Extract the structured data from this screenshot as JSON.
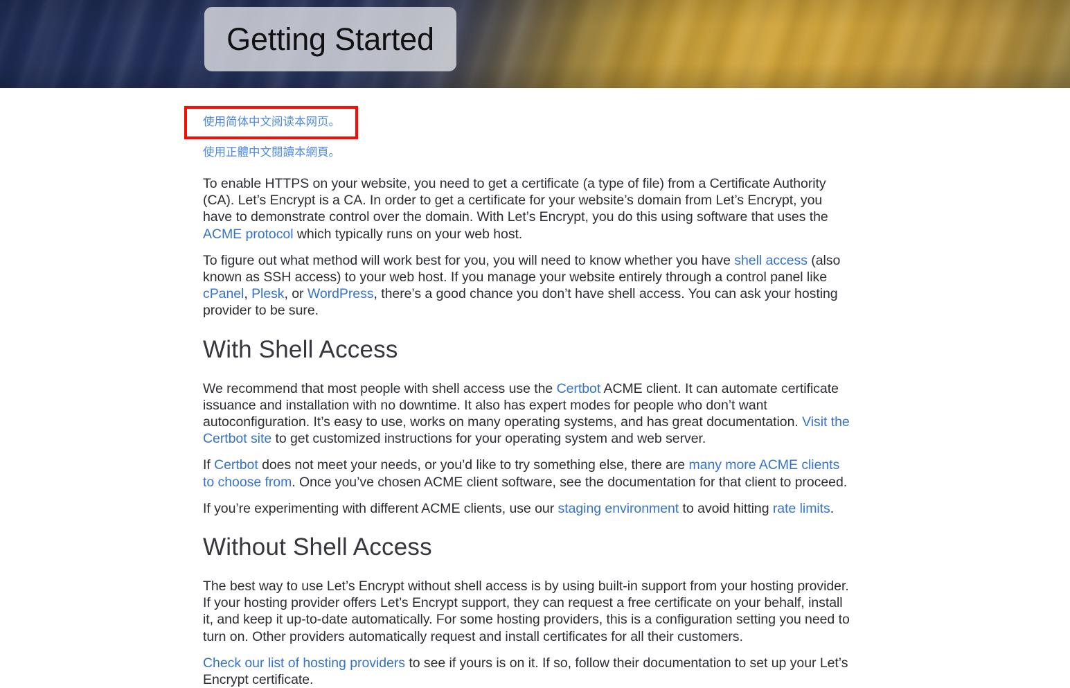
{
  "banner": {
    "title": "Getting Started",
    "gradient_from": "#1f2c55",
    "gradient_to": "#d2a63c",
    "title_box_bg": "rgba(222,224,228,0.80)"
  },
  "theme": {
    "link_color": "#4f8ae0",
    "body_text_color": "#2c2c33",
    "heading_color": "#36363e",
    "highlight_border_color": "#fb0a06",
    "page_background": "#ffffff"
  },
  "language_links": {
    "simplified_chinese": "使用简体中文阅读本网页。",
    "traditional_chinese": "使用正體中文閱讀本網頁。"
  },
  "intro": {
    "p1_a": "To enable HTTPS on your website, you need to get a certificate (a type of file) from a Certificate Authority (CA). Let’s Encrypt is a CA. In order to get a certificate for your website’s domain from Let’s Encrypt, you have to demonstrate control over the domain. With Let’s Encrypt, you do this using software that uses the ",
    "p1_link": "ACME protocol",
    "p1_b": " which typically runs on your web host.",
    "p2_a": "To figure out what method will work best for you, you will need to know whether you have ",
    "p2_link1": "shell access",
    "p2_b": " (also known as SSH access) to your web host. If you manage your website entirely through a control panel like ",
    "p2_link2": "cPanel",
    "p2_c": ", ",
    "p2_link3": "Plesk",
    "p2_d": ", or ",
    "p2_link4": "WordPress",
    "p2_e": ", there’s a good chance you don’t have shell access. You can ask your hosting provider to be sure."
  },
  "with_shell": {
    "heading": "With Shell Access",
    "p1_a": "We recommend that most people with shell access use the ",
    "p1_link1": "Certbot",
    "p1_b": " ACME client. It can automate certificate issuance and installation with no downtime. It also has expert modes for people who don’t want autoconfiguration. It’s easy to use, works on many operating systems, and has great documentation. ",
    "p1_link2": "Visit the Certbot site",
    "p1_c": " to get customized instructions for your operating system and web server.",
    "p2_a": "If ",
    "p2_link1": "Certbot",
    "p2_b": " does not meet your needs, or you’d like to try something else, there are ",
    "p2_link2": "many more ACME clients to choose from",
    "p2_c": ". Once you’ve chosen ACME client software, see the documentation for that client to proceed.",
    "p3_a": "If you’re experimenting with different ACME clients, use our ",
    "p3_link1": "staging environment",
    "p3_b": " to avoid hitting ",
    "p3_link2": "rate limits",
    "p3_c": "."
  },
  "without_shell": {
    "heading": "Without Shell Access",
    "p1": "The best way to use Let’s Encrypt without shell access is by using built-in support from your hosting provider. If your hosting provider offers Let’s Encrypt support, they can request a free certificate on your behalf, install it, and keep it up-to-date automatically. For some hosting providers, this is a configuration setting you need to turn on. Other providers automatically request and install certificates for all their customers.",
    "p2_link": "Check our list of hosting providers",
    "p2_rest": " to see if yours is on it. If so, follow their documentation to set up your Let’s Encrypt certificate."
  }
}
